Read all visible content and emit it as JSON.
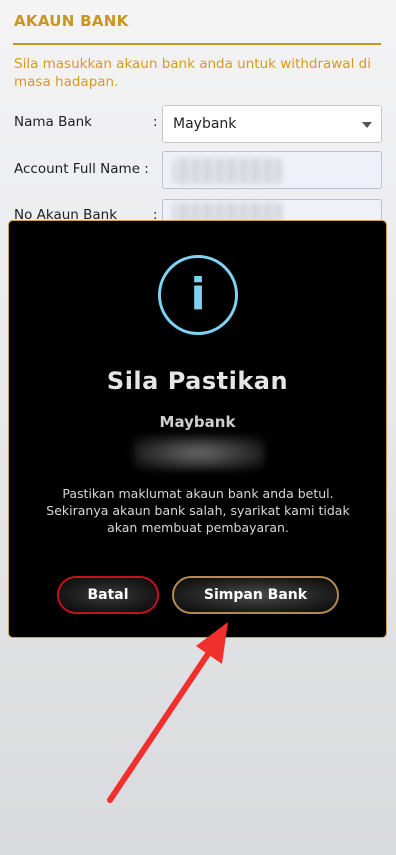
{
  "section": {
    "title": "AKAUN BANK",
    "instruction": "Sila masukkan akaun bank anda untuk withdrawal di masa hadapan."
  },
  "form": {
    "bank_name_label": "Nama Bank",
    "bank_name_value": "Maybank",
    "account_name_label": "Account Full Name :",
    "account_number_label": "No Akaun Bank",
    "colon": ":"
  },
  "modal": {
    "title": "Sila Pastikan",
    "bank": "Maybank",
    "message": "Pastikan maklumat akaun bank anda betul. Sekiranya akaun bank salah, syarikat kami tidak akan membuat pembayaran.",
    "cancel_label": "Batal",
    "save_label": "Simpan Bank"
  },
  "colors": {
    "accent_gold": "#c8961e",
    "info_blue": "#7fd3f2",
    "cancel_red": "#c0141c",
    "arrow_red": "#f0302c"
  },
  "icons": {
    "info": "info-icon",
    "dropdown": "chevron-down-icon",
    "annotation": "red-arrow-annotation"
  }
}
